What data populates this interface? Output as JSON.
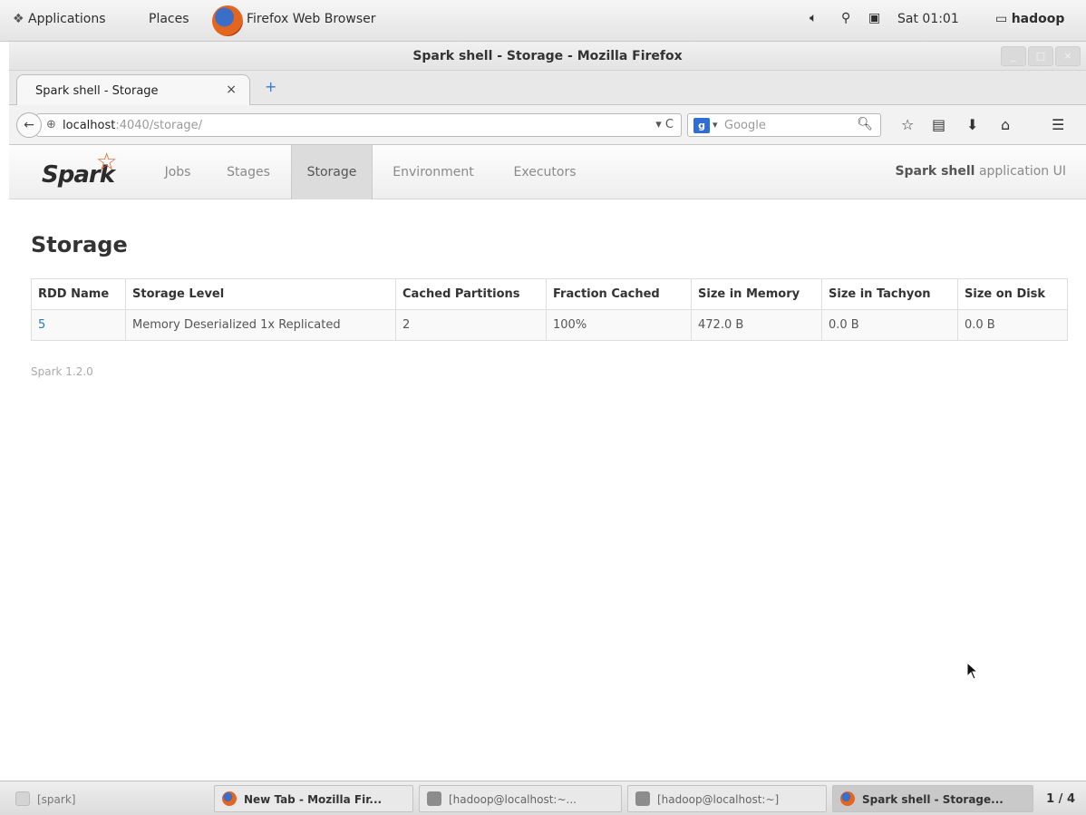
{
  "top_panel": {
    "applications": "Applications",
    "places": "Places",
    "app_name": "Firefox Web Browser",
    "clock": "Sat 01:01",
    "user": "hadoop"
  },
  "window": {
    "title": "Spark shell - Storage - Mozilla Firefox"
  },
  "browser": {
    "tab_title": "Spark shell - Storage",
    "tab_close": "×",
    "new_tab": "+",
    "url_host": "localhost",
    "url_path": ":4040/storage/",
    "search_engine": "g",
    "search_placeholder": "Google"
  },
  "spark": {
    "logo_text": "Spark",
    "nav": [
      "Jobs",
      "Stages",
      "Storage",
      "Environment",
      "Executors"
    ],
    "active_tab": "Storage",
    "app_name": "Spark shell",
    "app_suffix": "application UI",
    "page_title": "Storage",
    "table": {
      "headers": [
        "RDD Name",
        "Storage Level",
        "Cached Partitions",
        "Fraction Cached",
        "Size in Memory",
        "Size in Tachyon",
        "Size on Disk"
      ],
      "rows": [
        [
          "5",
          "Memory Deserialized 1x Replicated",
          "2",
          "100%",
          "472.0 B",
          "0.0 B",
          "0.0 B"
        ]
      ]
    },
    "version": "Spark 1.2.0"
  },
  "taskbar": {
    "items": [
      "[spark]",
      "New Tab - Mozilla Fir...",
      "[hadoop@localhost:~...",
      "[hadoop@localhost:~]",
      "Spark shell - Storage..."
    ],
    "pager": "1 / 4"
  },
  "colors": {
    "link": "#2a7ac0",
    "spark_orange": "#e25a1c"
  }
}
